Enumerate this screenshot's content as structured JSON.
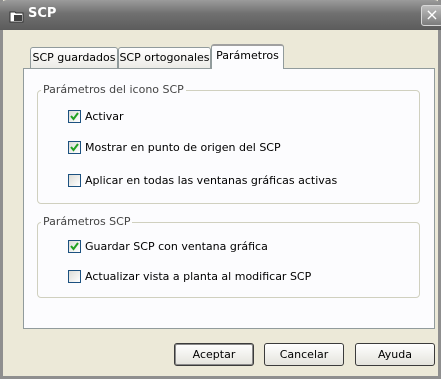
{
  "window": {
    "title": "SCP",
    "close_glyph": "×",
    "app_icon": "folder-icon"
  },
  "tabs": [
    {
      "label": "SCP guardados",
      "active": false
    },
    {
      "label": "SCP ortogonales",
      "active": false
    },
    {
      "label": "Parámetros",
      "active": true
    }
  ],
  "icon_params": {
    "legend": "Parámetros del icono SCP",
    "options": [
      {
        "label": "Activar",
        "checked": true
      },
      {
        "label": "Mostrar en punto de origen del SCP",
        "checked": true
      },
      {
        "label": "Aplicar en todas las ventanas gráficas activas",
        "checked": false
      }
    ]
  },
  "scp_params": {
    "legend": "Parámetros SCP",
    "options": [
      {
        "label": "Guardar SCP con ventana gráfica",
        "checked": true
      },
      {
        "label": "Actualizar vista a planta al modificar SCP",
        "checked": false
      }
    ]
  },
  "buttons": {
    "accept": "Aceptar",
    "cancel": "Cancelar",
    "help": "Ayuda"
  }
}
